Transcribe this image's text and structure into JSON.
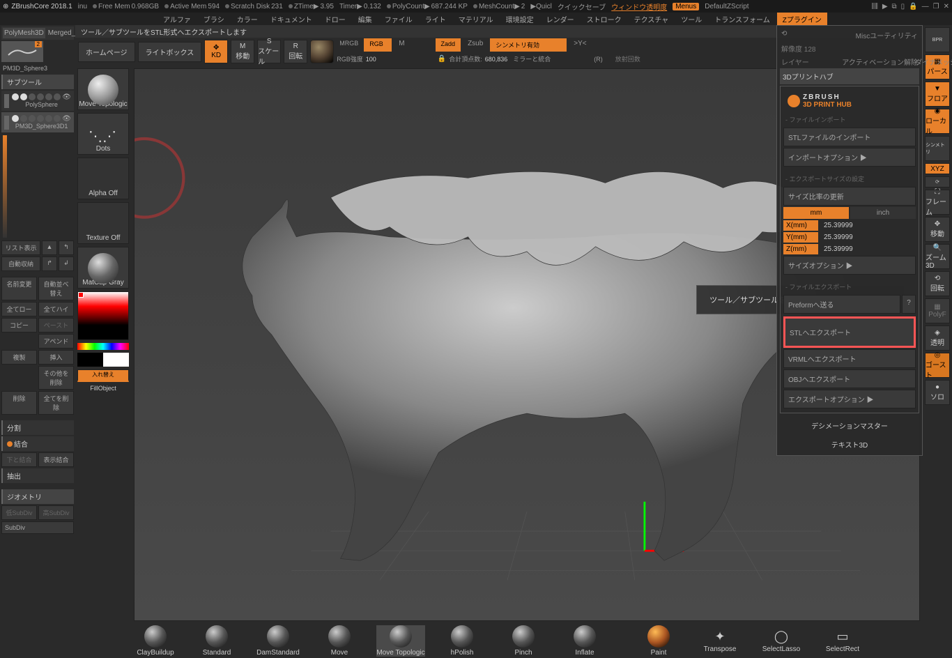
{
  "titlebar": {
    "app": "ZBrushCore 2018.1",
    "project": "inu",
    "stats": [
      {
        "label": "Free Mem",
        "value": "0.968GB"
      },
      {
        "label": "Active Mem",
        "value": "594"
      },
      {
        "label": "Scratch Disk",
        "value": "231"
      },
      {
        "label": "ZTime▶",
        "value": "3.95"
      },
      {
        "label": "Timer▶",
        "value": "0.132"
      },
      {
        "label": "PolyCount▶",
        "value": "687.244 KP"
      },
      {
        "label": "MeshCount▶",
        "value": "2"
      },
      {
        "label": "▶Quicl",
        "value": ""
      }
    ],
    "quicksave": "クイックセーブ",
    "window_trans": "ウィンドウ透明度",
    "menus_btn": "Menus",
    "default_script": "DefaultZScript"
  },
  "menubar": {
    "items": [
      "アルファ",
      "ブラシ",
      "カラー",
      "ドキュメント",
      "ドロー",
      "編集",
      "ファイル",
      "ライト",
      "マテリアル",
      "環境設定",
      "レンダー",
      "ストローク",
      "テクスチャ",
      "ツール",
      "トランスフォーム",
      "Zプラグイン"
    ],
    "active_index": 15
  },
  "hint": "ツール／サブツールをSTL形式へエクスポートします",
  "toolbar2": {
    "home": "ホームページ",
    "lightbox": "ライトボックス",
    "kd": "KD",
    "move": "移動",
    "scale": "スケール",
    "rotate": "回転",
    "mrgb": "MRGB",
    "rgb_btn": "RGB",
    "m": "M",
    "zadd": "Zadd",
    "zsub": "Zsub",
    "symmetry": "シンメトリ有効",
    "yarrow": ">Y<",
    "rgb_intensity_label": "RGB強度",
    "rgb_intensity": "100",
    "total_points_label": "合計頂点数:",
    "total_points": "680,836",
    "mirror": "ミラーと統合",
    "r": "(R)",
    "radial": "放射回数",
    "res_label": "解像度",
    "res": "128",
    "layer": "レイヤー"
  },
  "left": {
    "mesh_tabs": [
      "PolyMesh3D",
      "Merged_PolySp"
    ],
    "tool_name": "PM3D_Sphere3",
    "badge": "2",
    "subtool_title": "サブツール",
    "subtools": [
      {
        "name": "PolySphere"
      },
      {
        "name": "PM3D_Sphere3D1"
      }
    ],
    "list_show": "リスト表示",
    "auto_store": "自動収納",
    "btns": [
      [
        "名前変更",
        "自動並べ替え"
      ],
      [
        "全てロー",
        "全てハイ"
      ],
      [
        "コピー",
        "ペースト"
      ],
      [
        "",
        "アペンド"
      ],
      [
        "複製",
        "挿入"
      ],
      [
        "",
        "その他を削除"
      ],
      [
        "削除",
        "全てを削除"
      ]
    ],
    "split": "分割",
    "merge": "結合",
    "merge_down": "下と結合",
    "merge_show": "表示結合",
    "extract": "抽出",
    "geometry": "ジオメトリ",
    "low_sub": "低SubDiv",
    "high_sub": "高SubDiv",
    "subdiv": "SubDiv"
  },
  "brush_col": {
    "brush_name": "Move Topologic",
    "stroke": "Dots",
    "alpha": "Alpha Off",
    "texture": "Texture Off",
    "material": "MatCap Gray",
    "swap": "入れ替え",
    "fill": "FillObject"
  },
  "tooltip": "ツール／サブツールをSTL形式へエクスポートします",
  "bottom": {
    "brushes": [
      "ClayBuildup",
      "Standard",
      "DamStandard",
      "Move",
      "Move Topologic",
      "hPolish",
      "Pinch",
      "Inflate"
    ],
    "active_index": 4,
    "right_tools": [
      "Paint",
      "Transpose",
      "SelectLasso",
      "SelectRect"
    ]
  },
  "right_col": {
    "buttons": [
      "BPR",
      "パース",
      "フロア",
      "ローカル",
      "シンメトリ",
      "XYZ",
      "⟳",
      "フレーム",
      "移動",
      "ズーム3D",
      "回転",
      "PolyF",
      "透明",
      "ゴースト",
      "ソロ"
    ],
    "active": [
      1,
      2,
      3,
      13
    ]
  },
  "plugin": {
    "misc": "Miscユーティリティ",
    "deactivate": "アクティベーション解除",
    "dynamesh": "ダイナメッシュ",
    "print_hub": "3Dプリントハブ",
    "logo1": "ZBRUSH",
    "logo2": "3D PRINT HUB",
    "file_import": "- ファイルインポート",
    "stl_import": "STLファイルのインポート",
    "import_opts": "インポートオプション ▶",
    "export_size": "- エクスポートサイズの設定",
    "size_update": "サイズ比率の更新",
    "unit_mm": "mm",
    "unit_inch": "inch",
    "dims": [
      {
        "label": "X(mm)",
        "value": "25.39999"
      },
      {
        "label": "Y(mm)",
        "value": "25.39999"
      },
      {
        "label": "Z(mm)",
        "value": "25.39999"
      }
    ],
    "size_opts": "サイズオプション ▶",
    "file_export": "- ファイルエクスポート",
    "preform": "Preformへ送る",
    "q": "?",
    "stl_export": "STLへエクスポート",
    "vrml_export": "VRMLへエクスポート",
    "obj_export": "OBJへエクスポート",
    "export_opts": "エクスポートオプション ▶",
    "decimation": "デシメーションマスター",
    "text3d": "テキスト3D"
  }
}
